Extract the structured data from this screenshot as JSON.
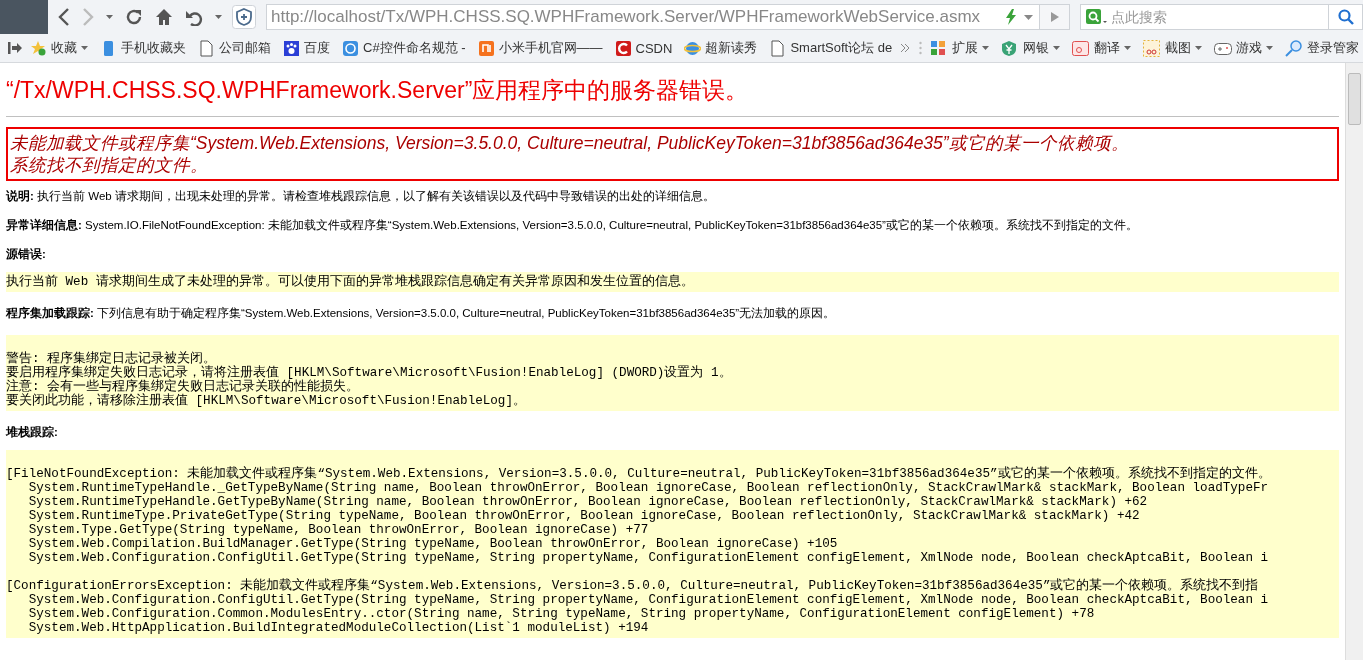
{
  "toolbar": {
    "address": "http://localhost/Tx/WPH.CHSS.SQ.WPHFramework.Server/WPHFrameworkWebService.asmx",
    "search": {
      "placeholder": "点此搜索"
    }
  },
  "bookmarks": {
    "left": [
      {
        "label": "收藏",
        "dropdown": true
      },
      {
        "label": "手机收藏夹",
        "dropdown": false
      },
      {
        "label": "公司邮箱",
        "dropdown": false
      },
      {
        "label": "百度",
        "dropdown": false
      },
      {
        "label": "C#控件命名规范 -",
        "dropdown": false
      },
      {
        "label": "小米手机官网——",
        "dropdown": false
      },
      {
        "label": "CSDN",
        "dropdown": false
      },
      {
        "label": "超新读秀",
        "dropdown": false
      },
      {
        "label": "SmartSoft论坛 de",
        "dropdown": false
      }
    ],
    "right": [
      {
        "label": "扩展",
        "dropdown": true
      },
      {
        "label": "网银",
        "dropdown": true
      },
      {
        "label": "翻译",
        "dropdown": true
      },
      {
        "label": "截图",
        "dropdown": true
      },
      {
        "label": "游戏",
        "dropdown": true
      },
      {
        "label": "登录管家",
        "dropdown": false
      }
    ]
  },
  "page": {
    "title": "“/Tx/WPH.CHSS.SQ.WPHFramework.Server”应用程序中的服务器错误。",
    "error_lines": [
      "未能加载文件或程序集“System.Web.Extensions, Version=3.5.0.0, Culture=neutral, PublicKeyToken=31bf3856ad364e35”或它的某一个依赖项。",
      "系统找不到指定的文件。"
    ],
    "sections": [
      {
        "kind": "text",
        "text": "**说明:** 执行当前 Web 请求期间，出现未处理的异常。请检查堆栈跟踪信息，以了解有关该错误以及代码中导致错误的出处的详细信息。"
      },
      {
        "kind": "text",
        "text": "**异常详细信息:** System.IO.FileNotFoundException: 未能加载文件或程序集“System.Web.Extensions, Version=3.5.0.0, Culture=neutral, PublicKeyToken=31bf3856ad364e35”或它的某一个依赖项。系统找不到指定的文件。"
      },
      {
        "kind": "heading",
        "text": "源错误:"
      },
      {
        "kind": "code",
        "lines": [
          "执行当前 Web 请求期间生成了未处理的异常。可以使用下面的异常堆栈跟踪信息确定有关异常原因和发生位置的信息。"
        ]
      },
      {
        "kind": "text",
        "text": "**程序集加载跟踪:** 下列信息有助于确定程序集“System.Web.Extensions, Version=3.5.0.0, Culture=neutral, PublicKeyToken=31bf3856ad364e35”无法加载的原因。"
      },
      {
        "kind": "code",
        "lines": [
          "警告: 程序集绑定日志记录被关闭。",
          "要启用程序集绑定失败日志记录，请将注册表值 [HKLM\\Software\\Microsoft\\Fusion!EnableLog] (DWORD)设置为 1。",
          "注意: 会有一些与程序集绑定失败日志记录关联的性能损失。",
          "要关闭此功能，请移除注册表值 [HKLM\\Software\\Microsoft\\Fusion!EnableLog]。"
        ]
      },
      {
        "kind": "heading",
        "text": "堆栈跟踪:"
      },
      {
        "kind": "code",
        "groups": [
          [
            "[FileNotFoundException: 未能加载文件或程序集“System.Web.Extensions, Version=3.5.0.0, Culture=neutral, PublicKeyToken=31bf3856ad364e35”或它的某一个依赖项。系统找不到指定的文件。",
            "   System.RuntimeTypeHandle._GetTypeByName(String name, Boolean throwOnError, Boolean ignoreCase, Boolean reflectionOnly, StackCrawlMark& stackMark, Boolean loadTypeFr",
            "   System.RuntimeTypeHandle.GetTypeByName(String name, Boolean throwOnError, Boolean ignoreCase, Boolean reflectionOnly, StackCrawlMark& stackMark) +62",
            "   System.RuntimeType.PrivateGetType(String typeName, Boolean throwOnError, Boolean ignoreCase, Boolean reflectionOnly, StackCrawlMark& stackMark) +42",
            "   System.Type.GetType(String typeName, Boolean throwOnError, Boolean ignoreCase) +77",
            "   System.Web.Compilation.BuildManager.GetType(String typeName, Boolean throwOnError, Boolean ignoreCase) +105",
            "   System.Web.Configuration.ConfigUtil.GetType(String typeName, String propertyName, ConfigurationElement configElement, XmlNode node, Boolean checkAptcaBit, Boolean i"
          ],
          [
            "[ConfigurationErrorsException: 未能加载文件或程序集“System.Web.Extensions, Version=3.5.0.0, Culture=neutral, PublicKeyToken=31bf3856ad364e35”或它的某一个依赖项。系统找不到指",
            "   System.Web.Configuration.ConfigUtil.GetType(String typeName, String propertyName, ConfigurationElement configElement, XmlNode node, Boolean checkAptcaBit, Boolean i",
            "   System.Web.Configuration.Common.ModulesEntry..ctor(String name, String typeName, String propertyName, ConfigurationElement configElement) +78",
            "   System.Web.HttpApplication.BuildIntegratedModuleCollection(List`1 moduleList) +194"
          ]
        ]
      }
    ]
  }
}
